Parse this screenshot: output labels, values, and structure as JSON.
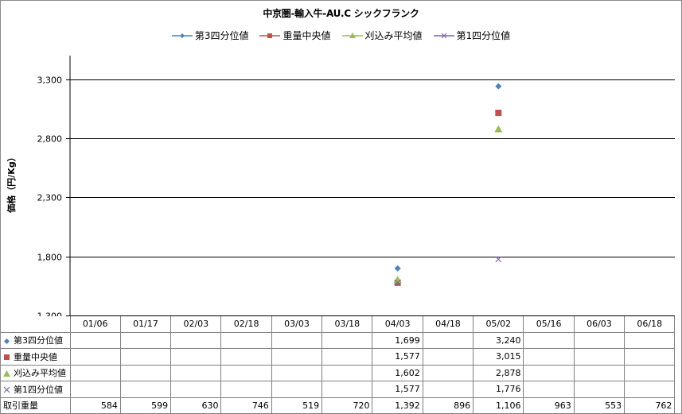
{
  "chart_data": {
    "type": "scatter",
    "title": "中京圏-輸入牛-AU.C シックフランク",
    "ylabel": "価格（円/Kg）",
    "xlabel": "",
    "ylim": [
      1300,
      3500
    ],
    "yticks": [
      1300,
      1800,
      2300,
      2800,
      3300
    ],
    "ytick_labels": [
      "1,300",
      "1,800",
      "2,300",
      "2,800",
      "3,300"
    ],
    "grid": true,
    "legend_position": "top",
    "categories": [
      "01/06",
      "01/17",
      "02/03",
      "02/18",
      "03/03",
      "03/18",
      "04/03",
      "04/18",
      "05/02",
      "05/16",
      "06/03",
      "06/18"
    ],
    "series": [
      {
        "name": "第3四分位値",
        "color": "#4f81bd",
        "marker": "diamond",
        "values": [
          null,
          null,
          null,
          null,
          null,
          null,
          1699,
          null,
          3240,
          null,
          null,
          null
        ],
        "labels": [
          "",
          "",
          "",
          "",
          "",
          "",
          "1,699",
          "",
          "3,240",
          "",
          "",
          ""
        ]
      },
      {
        "name": "重量中央値",
        "color": "#c0504d",
        "marker": "square",
        "values": [
          null,
          null,
          null,
          null,
          null,
          null,
          1577,
          null,
          3015,
          null,
          null,
          null
        ],
        "labels": [
          "",
          "",
          "",
          "",
          "",
          "",
          "1,577",
          "",
          "3,015",
          "",
          "",
          ""
        ]
      },
      {
        "name": "刈込み平均値",
        "color": "#9bbb59",
        "marker": "triangle",
        "values": [
          null,
          null,
          null,
          null,
          null,
          null,
          1602,
          null,
          2878,
          null,
          null,
          null
        ],
        "labels": [
          "",
          "",
          "",
          "",
          "",
          "",
          "1,602",
          "",
          "2,878",
          "",
          "",
          ""
        ]
      },
      {
        "name": "第1四分位値",
        "color": "#8064a2",
        "marker": "x",
        "values": [
          null,
          null,
          null,
          null,
          null,
          null,
          1577,
          null,
          1776,
          null,
          null,
          null
        ],
        "labels": [
          "",
          "",
          "",
          "",
          "",
          "",
          "1,577",
          "",
          "1,776",
          "",
          "",
          ""
        ]
      }
    ],
    "table_extra_row": {
      "name": "取引重量",
      "values": [
        "584",
        "599",
        "630",
        "746",
        "519",
        "720",
        "1,392",
        "896",
        "1,106",
        "963",
        "553",
        "762"
      ]
    }
  }
}
